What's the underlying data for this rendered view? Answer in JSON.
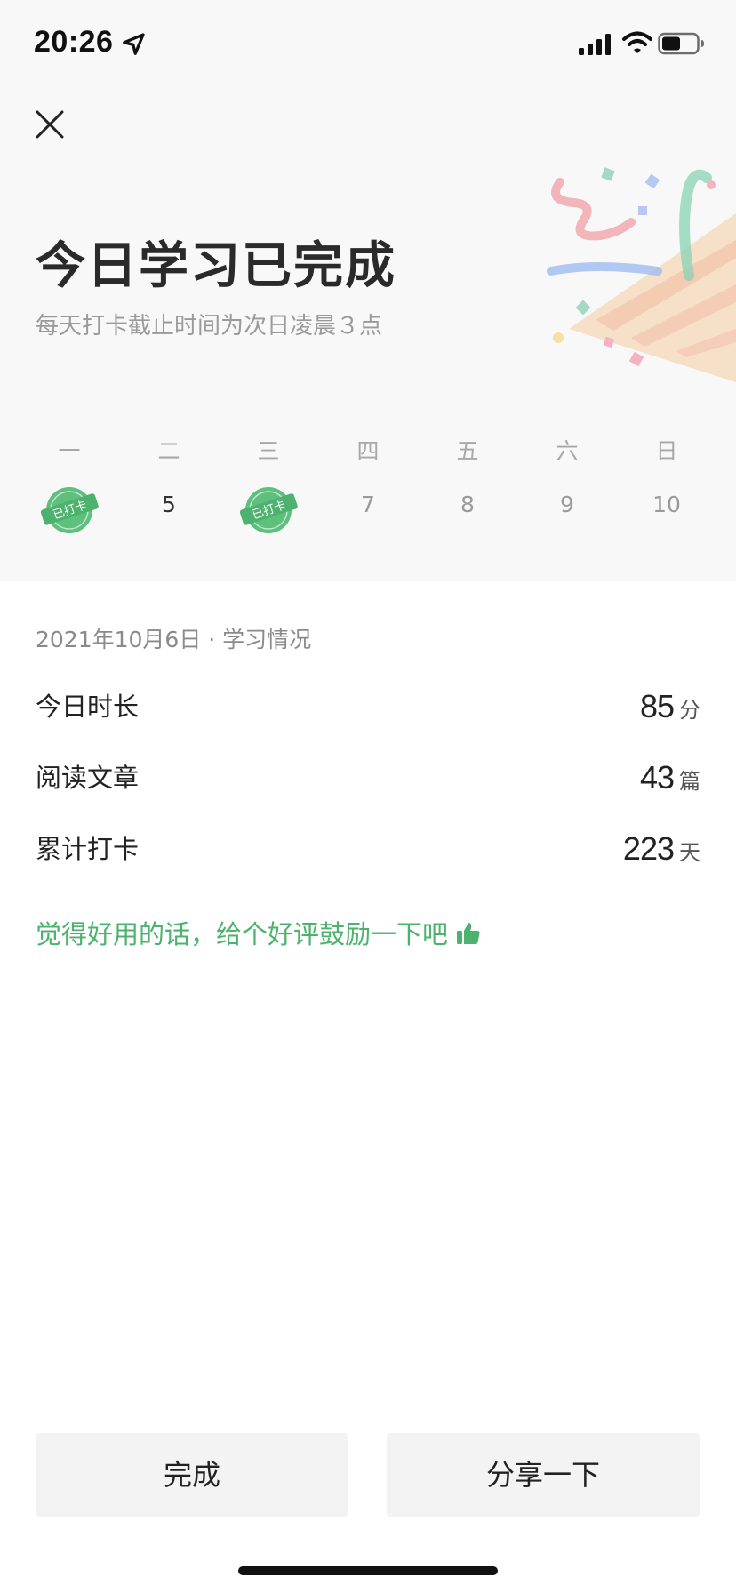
{
  "status_bar": {
    "time": "20:26"
  },
  "header": {
    "title": "今日学习已完成",
    "subtitle": "每天打卡截止时间为次日凌晨３点"
  },
  "week": {
    "days": [
      {
        "label": "一",
        "date": "",
        "checked_in": true
      },
      {
        "label": "二",
        "date": "5",
        "checked_in": false,
        "today": true
      },
      {
        "label": "三",
        "date": "",
        "checked_in": true
      },
      {
        "label": "四",
        "date": "7",
        "checked_in": false
      },
      {
        "label": "五",
        "date": "8",
        "checked_in": false
      },
      {
        "label": "六",
        "date": "9",
        "checked_in": false
      },
      {
        "label": "日",
        "date": "10",
        "checked_in": false
      }
    ],
    "stamp_text": "已打卡",
    "stamp_color": "#4cb26d"
  },
  "summary": {
    "title": "2021年10月6日 · 学习情况",
    "stats": [
      {
        "label": "今日时长",
        "value": "85",
        "unit": "分"
      },
      {
        "label": "阅读文章",
        "value": "43",
        "unit": "篇"
      },
      {
        "label": "累计打卡",
        "value": "223",
        "unit": "天"
      }
    ]
  },
  "rating": {
    "text": "觉得好用的话，给个好评鼓励一下吧",
    "icon": "thumbs-up-icon",
    "color": "#4cb26d"
  },
  "actions": {
    "done_label": "完成",
    "share_label": "分享一下"
  }
}
